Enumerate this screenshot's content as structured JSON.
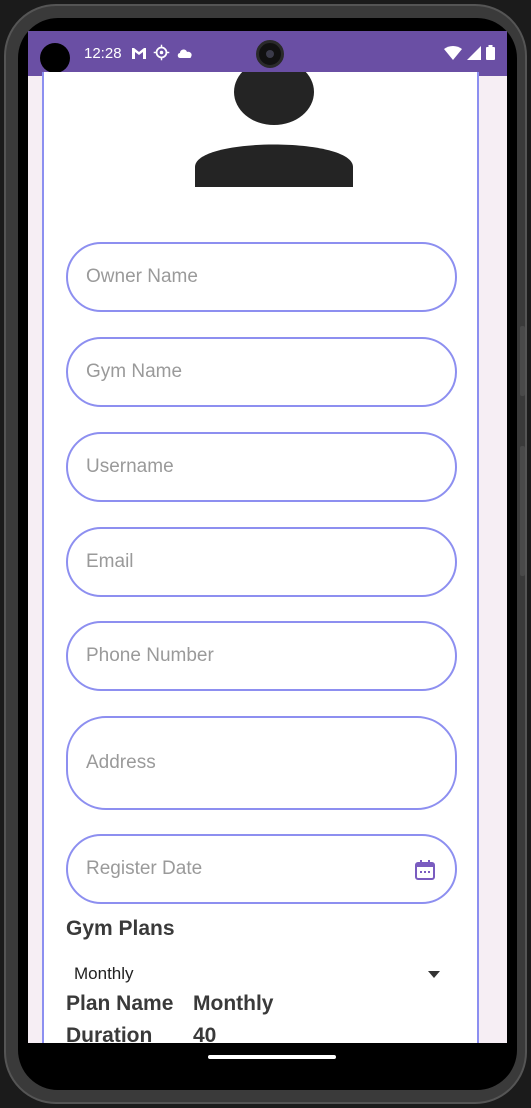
{
  "status_bar": {
    "time": "12:28",
    "left_icons": [
      "gmail-icon",
      "settings-cog-icon",
      "cloud-icon"
    ],
    "right_icons": [
      "wifi-icon",
      "signal-icon",
      "battery-icon"
    ],
    "color": "#6a4fa4"
  },
  "form": {
    "fields": [
      {
        "placeholder": "Owner Name"
      },
      {
        "placeholder": "Gym Name"
      },
      {
        "placeholder": "Username"
      },
      {
        "placeholder": "Email"
      },
      {
        "placeholder": "Phone Number"
      },
      {
        "placeholder": "Address"
      },
      {
        "placeholder": "Register Date"
      }
    ],
    "accent_color": "#8d8ff0"
  },
  "plans": {
    "section_title": "Gym Plans",
    "selected_plan": "Monthly",
    "plan_name_label": "Plan Name",
    "plan_name_value": "Monthly",
    "duration_label": "Duration",
    "duration_value": "40"
  }
}
